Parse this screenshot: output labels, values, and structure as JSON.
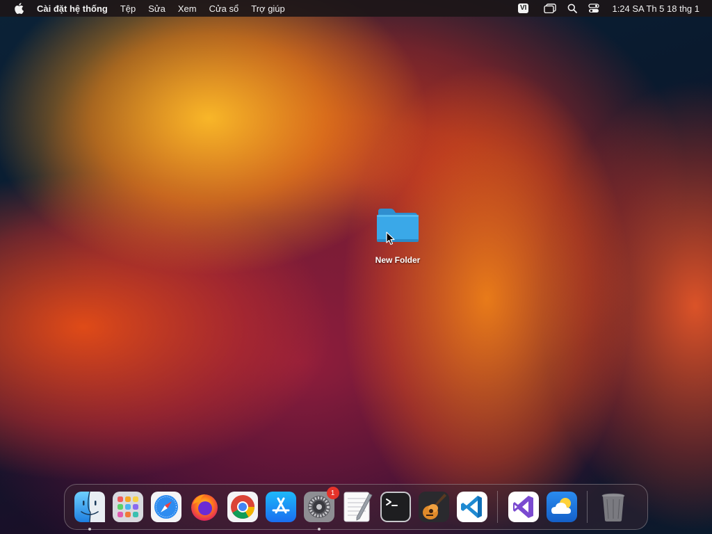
{
  "menubar": {
    "app_name": "Cài đặt hệ thống",
    "items": [
      "Tệp",
      "Sửa",
      "Xem",
      "Cửa sổ",
      "Trợ giúp"
    ],
    "input_source": "VI",
    "clock": "1:24 SA Th 5 18 thg 1"
  },
  "desktop": {
    "folder_label": "New Folder"
  },
  "dock": {
    "apps": [
      {
        "name": "Finder",
        "icon": "finder-icon",
        "running": true
      },
      {
        "name": "Launchpad",
        "icon": "launchpad-icon",
        "running": false
      },
      {
        "name": "Safari",
        "icon": "safari-icon",
        "running": false
      },
      {
        "name": "Firefox",
        "icon": "firefox-icon",
        "running": false
      },
      {
        "name": "Google Chrome",
        "icon": "chrome-icon",
        "running": false
      },
      {
        "name": "App Store",
        "icon": "app-store-icon",
        "running": false
      },
      {
        "name": "System Settings",
        "icon": "system-settings-icon",
        "running": true,
        "badge": "1"
      },
      {
        "name": "TextEdit",
        "icon": "textedit-icon",
        "running": false
      },
      {
        "name": "Terminal",
        "icon": "terminal-icon",
        "running": false
      },
      {
        "name": "GarageBand",
        "icon": "garageband-icon",
        "running": false
      },
      {
        "name": "Visual Studio Code",
        "icon": "vscode-icon",
        "running": false
      },
      {
        "name": "Visual Studio",
        "icon": "visual-studio-icon",
        "running": false
      },
      {
        "name": "Weather",
        "icon": "weather-icon",
        "running": false
      },
      {
        "name": "Trash",
        "icon": "trash-icon",
        "running": false
      }
    ]
  },
  "colors": {
    "menubar_bg": "#1c1618",
    "folder_blue": "#3aa8e8",
    "badge_red": "#e5332a"
  }
}
